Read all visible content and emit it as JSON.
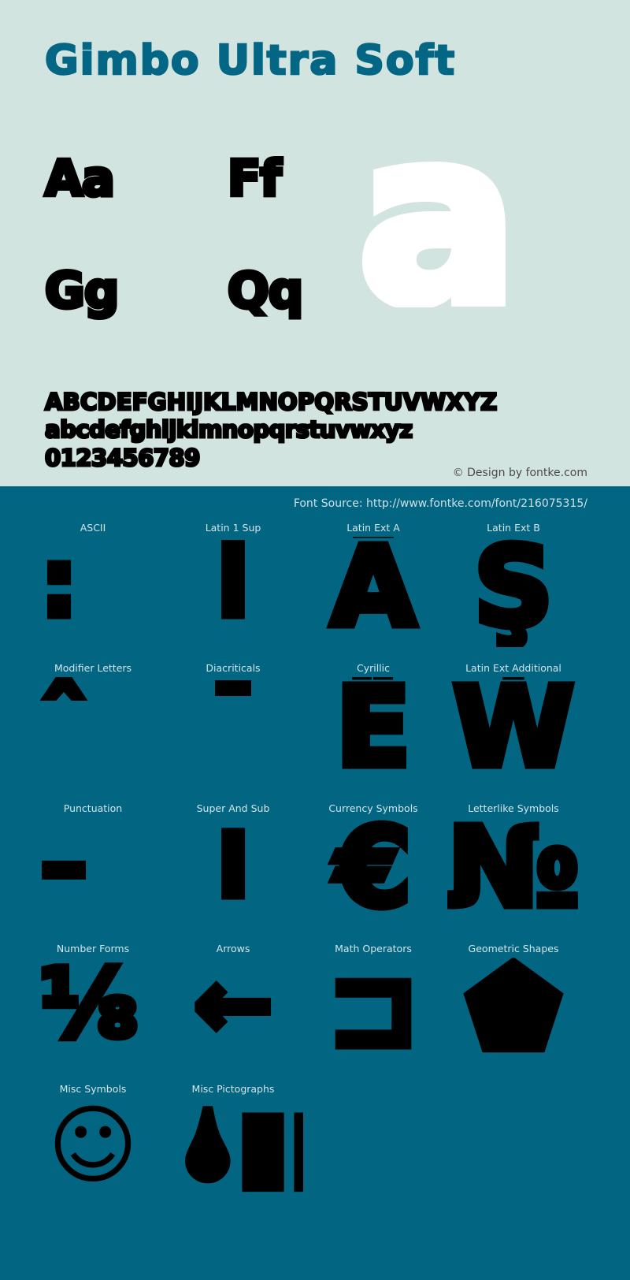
{
  "colors": {
    "specimen_bg": "#d2e4df",
    "coverage_bg": "#026582",
    "title_color": "#036684",
    "glyph_black": "#000000",
    "glyph_white": "#ffffff",
    "label_color": "#d4e5e9",
    "credit_color": "#4a4a4a"
  },
  "specimen": {
    "title": "Gimbo Ultra Soft",
    "letter_pairs": [
      {
        "name": "aa",
        "text": "Aa"
      },
      {
        "name": "ff",
        "text": "Ff"
      },
      {
        "name": "gg",
        "text": "Gg"
      },
      {
        "name": "qq",
        "text": "Qq"
      }
    ],
    "feature_glyph": "a",
    "alphabet": {
      "uppercase": "ABCDEFGHIJKLMNOPQRSTUVWXYZ",
      "lowercase": "abcdefghijklmnopqrstuvwxyz",
      "digits": "0123456789"
    },
    "credit": "© Design by fontke.com"
  },
  "coverage": {
    "source": "Font Source: http://www.fontke.com/font/216075315/",
    "rows": [
      [
        {
          "label": "ASCII",
          "sample": ":"
        },
        {
          "label": "Latin 1 Sup",
          "sample": "i"
        },
        {
          "label": "Latin Ext A",
          "sample": "Ā"
        },
        {
          "label": "Latin Ext B",
          "sample": "Ş"
        }
      ],
      [
        {
          "label": "Modifier Letters",
          "sample": "ˆ"
        },
        {
          "label": "Diacriticals",
          "sample": "¯"
        },
        {
          "label": "Cyrillic",
          "sample": "Ё"
        },
        {
          "label": "Latin Ext Additional",
          "sample": "Ẇ"
        }
      ],
      [
        {
          "label": "Punctuation",
          "sample": "–"
        },
        {
          "label": "Super And Sub",
          "sample": "⁞"
        },
        {
          "label": "Currency Symbols",
          "sample": "€"
        },
        {
          "label": "Letterlike Symbols",
          "sample": "№"
        }
      ],
      [
        {
          "label": "Number Forms",
          "sample": "⅛"
        },
        {
          "label": "Arrows",
          "sample": "←"
        },
        {
          "label": "Math Operators",
          "sample": "⊐"
        },
        {
          "label": "Geometric Shapes",
          "sample": "⬟"
        }
      ],
      [
        {
          "label": "Misc Symbols",
          "sample": "☺"
        },
        {
          "label": "Misc Pictographs",
          "sample": "🌢▮▮▮"
        }
      ]
    ]
  }
}
